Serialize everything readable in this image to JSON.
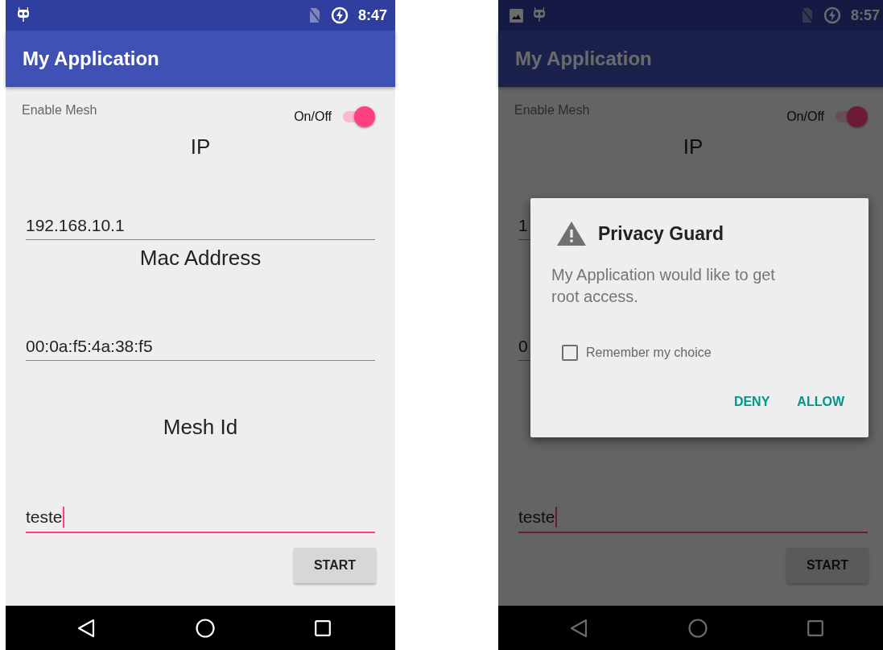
{
  "screens": [
    {
      "notification_icons": [
        {
          "kind": "robot"
        }
      ],
      "time": "8:47",
      "title": "My Application",
      "enable_label": "Enable Mesh",
      "switch": {
        "label": "On/Off",
        "on": true
      },
      "fields": [
        {
          "label": "IP",
          "value": "192.168.10.1",
          "focused": false
        },
        {
          "label": "Mac Address",
          "value": "00:0a:f5:4a:38:f5",
          "focused": false
        },
        {
          "label": "Mesh Id",
          "value": "teste",
          "focused": true
        }
      ],
      "start_button": "START"
    },
    {
      "notification_icons": [
        {
          "kind": "image"
        },
        {
          "kind": "robot"
        }
      ],
      "time": "8:57",
      "title": "My Application",
      "enable_label": "Enable Mesh",
      "switch": {
        "label": "On/Off",
        "on": true
      },
      "fields": [
        {
          "label": "IP",
          "value": "1",
          "focused": false
        },
        {
          "value": "0",
          "focused": false
        },
        {
          "value": "teste",
          "focused": true
        }
      ],
      "start_button": "START",
      "dialog": {
        "title": "Privacy Guard",
        "message": "My Application would like to get root access.",
        "checkbox": {
          "label": "Remember my choice",
          "checked": false
        },
        "buttons": [
          "DENY",
          "ALLOW"
        ]
      }
    }
  ]
}
